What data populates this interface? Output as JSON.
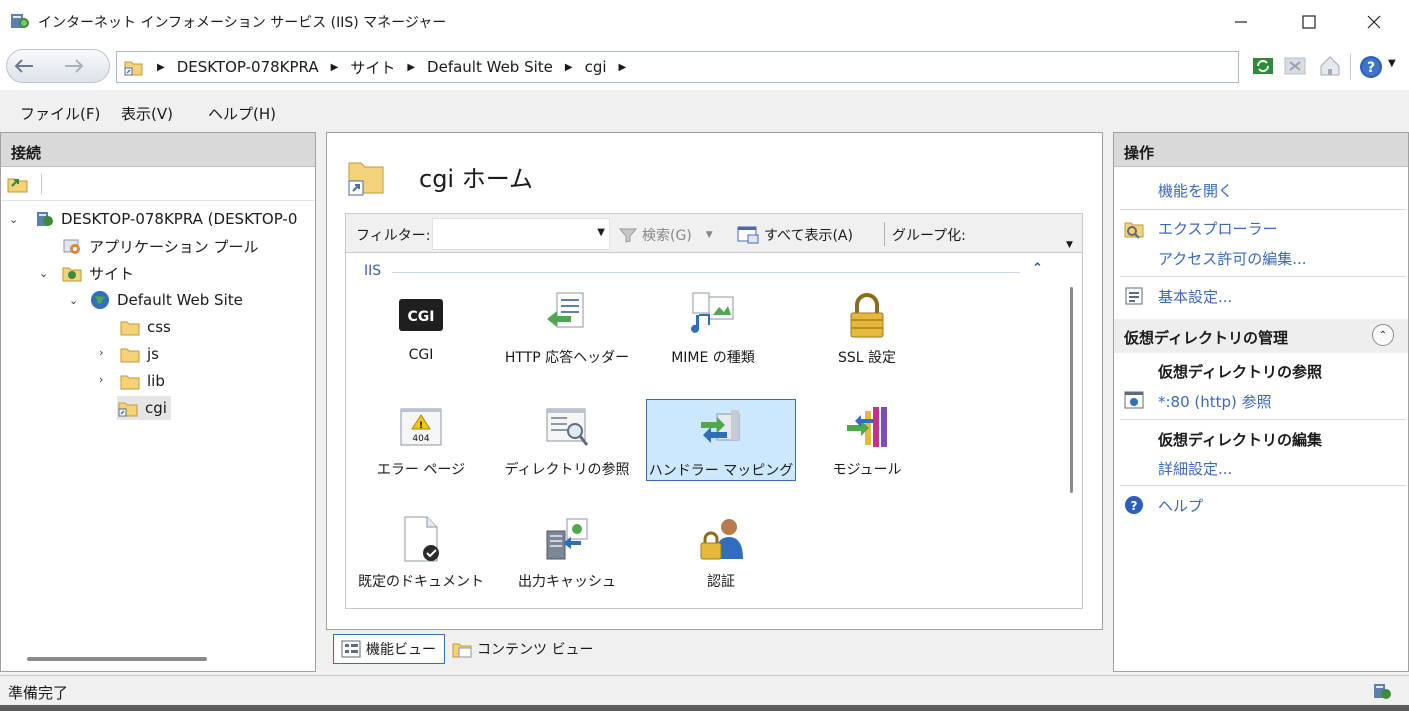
{
  "window": {
    "title": "インターネット インフォメーション サービス (IIS) マネージャー"
  },
  "address": {
    "crumbs": [
      "DESKTOP-078KPRA",
      "サイト",
      "Default Web Site",
      "cgi"
    ]
  },
  "menu": {
    "file": "ファイル(F)",
    "view": "表示(V)",
    "help": "ヘルプ(H)"
  },
  "connections": {
    "title": "接続",
    "tree": {
      "server": "DESKTOP-078KPRA (DESKTOP-0",
      "app_pools": "アプリケーション プール",
      "sites": "サイト",
      "default_site": "Default Web Site",
      "css": "css",
      "js": "js",
      "lib": "lib",
      "cgi": "cgi"
    }
  },
  "center": {
    "home_title": "cgi ホーム",
    "filter_label": "フィルター:",
    "filter_value": "",
    "search": "検索(G)",
    "show_all": "すべて表示(A)",
    "group_by": "グループ化:",
    "group": "IIS",
    "features": [
      {
        "label": "CGI",
        "icon": "cgi-icon"
      },
      {
        "label": "HTTP 応答ヘッダー",
        "icon": "http-headers-icon"
      },
      {
        "label": "MIME の種類",
        "icon": "mime-types-icon"
      },
      {
        "label": "SSL 設定",
        "icon": "ssl-lock-icon"
      },
      {
        "label": "エラー ページ",
        "icon": "error-pages-icon"
      },
      {
        "label": "ディレクトリの参照",
        "icon": "directory-browsing-icon"
      },
      {
        "label": "ハンドラー マッピング",
        "icon": "handler-mappings-icon"
      },
      {
        "label": "モジュール",
        "icon": "modules-icon"
      },
      {
        "label": "既定のドキュメント",
        "icon": "default-document-icon"
      },
      {
        "label": "出力キャッシュ",
        "icon": "output-caching-icon"
      },
      {
        "label": "認証",
        "icon": "authentication-icon"
      }
    ],
    "icon_404_text": "404",
    "view_tabs": {
      "features": "機能ビュー",
      "content": "コンテンツ ビュー"
    }
  },
  "actions": {
    "title": "操作",
    "open_feature": "機能を開く",
    "explore": "エクスプローラー",
    "edit_permissions": "アクセス許可の編集...",
    "basic_settings": "基本設定...",
    "vdir_section": "仮想ディレクトリの管理",
    "browse_vdir": "仮想ディレクトリの参照",
    "browse_link": "*:80 (http) 参照",
    "edit_vdir": "仮想ディレクトリの編集",
    "advanced_settings": "詳細設定...",
    "help": "ヘルプ"
  },
  "status": {
    "text": "準備完了"
  }
}
